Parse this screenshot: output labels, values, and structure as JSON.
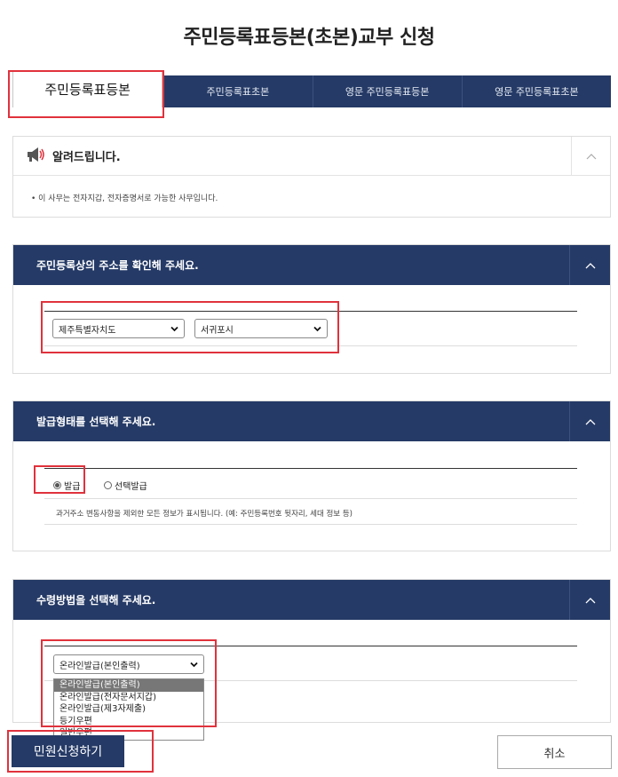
{
  "page_title": "주민등록표등본(초본)교부 신청",
  "tabs": [
    {
      "label": "주민등록표등본",
      "active": true
    },
    {
      "label": "주민등록표초본",
      "active": false
    },
    {
      "label": "영문 주민등록표등본",
      "active": false
    },
    {
      "label": "영문 주민등록표초본",
      "active": false
    }
  ],
  "notice": {
    "title": "알려드립니다.",
    "text": "• 이 사무는 전자지갑, 전자증명서로 가능한 사무입니다."
  },
  "address_section": {
    "title": "주민등록상의 주소를 확인해 주세요.",
    "province_value": "제주특별자치도",
    "city_value": "서귀포시"
  },
  "issuance_section": {
    "title": "발급형태를 선택해 주세요.",
    "option_issue": "발급",
    "option_select": "선택발급",
    "selected": "발급",
    "hint": "과거주소 변동사항을 제외한 모든 정보가 표시됩니다. (예: 주민등록번호 뒷자리, 세대 정보 등)"
  },
  "receipt_section": {
    "title": "수령방법을 선택해 주세요.",
    "select_value": "온라인발급(본인출력)",
    "options": [
      "온라인발급(본인출력)",
      "온라인발급(전자문서지갑)",
      "온라인발급(제3자제출)",
      "등기우편",
      "일반우편"
    ]
  },
  "buttons": {
    "apply": "민원신청하기",
    "cancel": "취소"
  },
  "colors": {
    "primary_navy": "#253a66",
    "highlight_red": "#e0323c"
  }
}
